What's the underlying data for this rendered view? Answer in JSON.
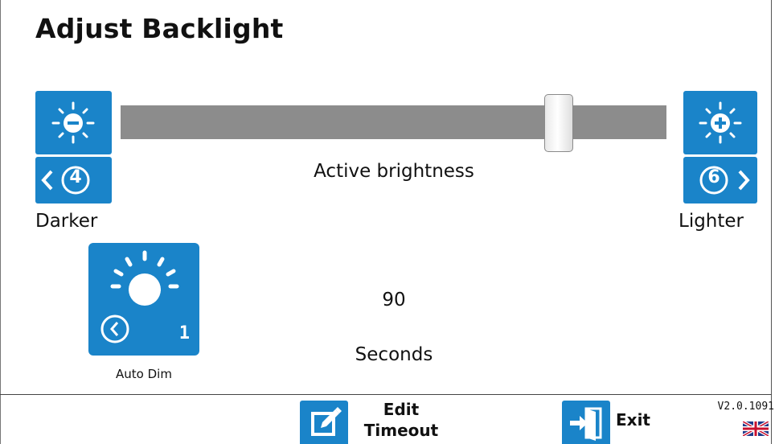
{
  "screen": {
    "title": "Adjust Backlight"
  },
  "brightness": {
    "active_label": "Active brightness",
    "darker_label": "Darker",
    "lighter_label": "Lighter",
    "decrease_step": "4",
    "increase_step": "6",
    "level_fraction": 0.82
  },
  "auto_dim": {
    "label": "Auto Dim",
    "badge": "1",
    "timeout_value": "90",
    "timeout_unit": "Seconds"
  },
  "footer": {
    "edit_timeout_line1": "Edit",
    "edit_timeout_line2": "Timeout",
    "exit_label": "Exit",
    "version": "V2.0.1091"
  },
  "colors": {
    "accent": "#1a84c9",
    "track": "#8c8c8c"
  },
  "icons": {
    "darker": "brightness-minus-icon",
    "lighter": "brightness-plus-icon",
    "auto_dim": "sun-timer-icon",
    "edit": "edit-icon",
    "exit": "exit-door-icon",
    "language": "uk-flag-icon"
  }
}
